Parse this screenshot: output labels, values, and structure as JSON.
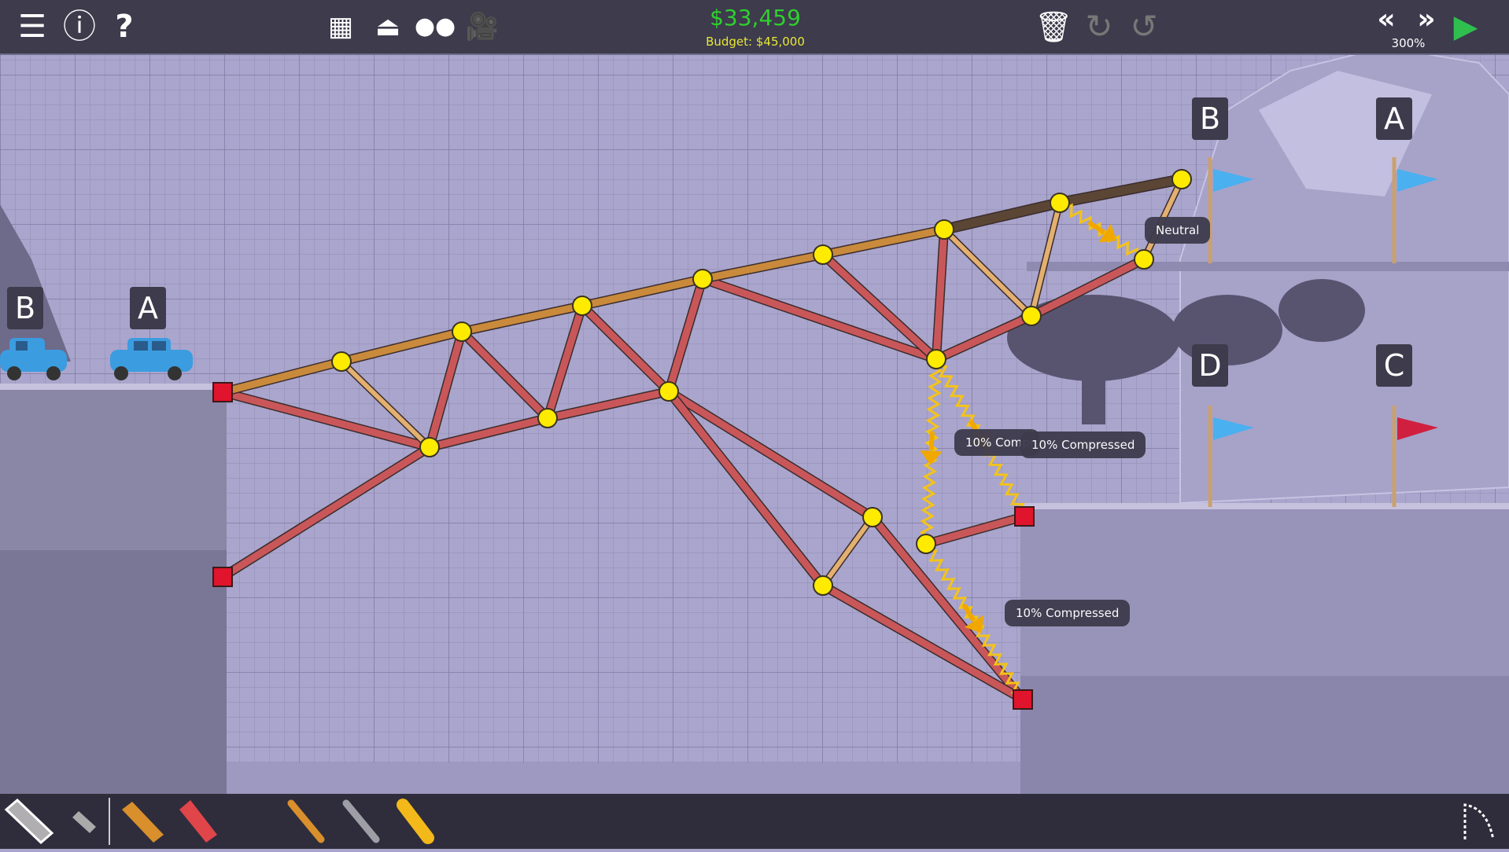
{
  "toolbar": {
    "menu_icon": "hamburger-menu-icon",
    "info_icon": "info-icon",
    "help_icon": "question-icon",
    "money": "$33,459",
    "budget": "Budget: $45,000",
    "speed": "300%"
  },
  "labels": {
    "neutral": "Neutral",
    "compressed_partial": "10% Compr",
    "compressed_1": "10% Compressed",
    "compressed_2": "10% Compressed"
  },
  "checkpoints": {
    "left_b": "B",
    "left_a": "A",
    "right_b": "B",
    "right_a": "A",
    "right_d": "D",
    "right_c": "C"
  },
  "colors": {
    "steel": "#c9575a",
    "wood": "#e3b070",
    "road": "#5b4636",
    "road_wood": "#c98a3c",
    "spring": "#f3c31a",
    "joint": "#ffeb00",
    "anchor": "#e0142c"
  }
}
